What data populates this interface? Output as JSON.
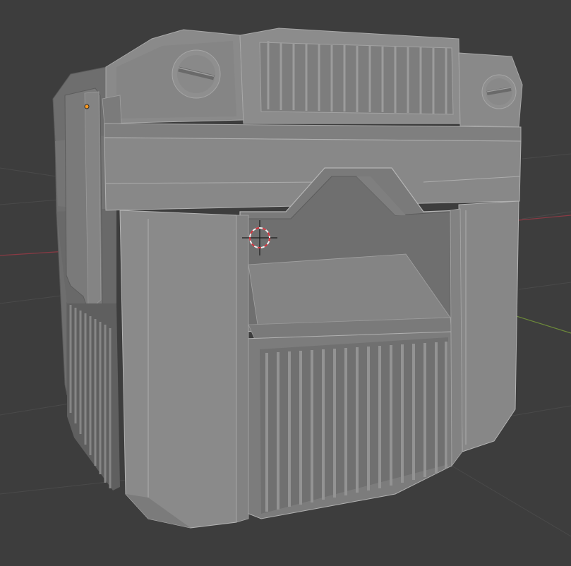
{
  "viewport": {
    "background_color": "#3d3d3d",
    "grid_color": "#4a4a4a",
    "x_axis_color": "#8a3a44",
    "y_axis_color": "#6d8a3a"
  },
  "model": {
    "base_color": "#808080",
    "light_face_color": "#939393",
    "dark_face_color": "#6b6b6b",
    "edge_highlight_color": "#c8c8c8"
  },
  "icons": {
    "cursor": "3d-cursor-icon",
    "origin": "object-origin-icon"
  },
  "colors": {
    "cursor_red": "#d4323c",
    "cursor_white": "#f0f0f0",
    "origin_orange": "#ff9a1f"
  }
}
